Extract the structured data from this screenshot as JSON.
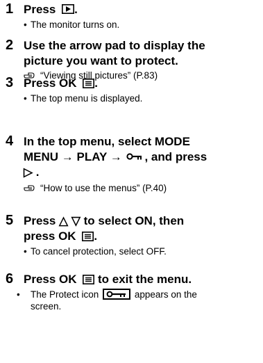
{
  "steps": [
    {
      "num": "1",
      "head_before": "Press",
      "head_after": ".",
      "button_icon": "playback-button-icon",
      "notes": [
        "The monitor turns on."
      ]
    },
    {
      "num": "2",
      "head_line1": "Use the arrow pad to display the",
      "head_line2": "picture you want to protect.",
      "ref_icon": "reference-hand-icon",
      "ref_text": "“Viewing still pictures” (P.83)"
    },
    {
      "num": "3",
      "head_before": "Press  OK",
      "head_after": ".",
      "button_icon": "menu-button-icon",
      "notes": [
        "The top menu is displayed."
      ]
    },
    {
      "num": "4",
      "head_line1": "In the top menu, select MODE",
      "head_line2_before": "MENU → PLAY →",
      "head_line2_after": ", and press",
      "head_line3": "▷ .",
      "key_icon": "protect-key-icon",
      "ref_icon": "reference-hand-icon",
      "ref_text": "“How to use the menus” (P.40)"
    },
    {
      "num": "5",
      "head_line1": "Press  △ ▽  to select ON, then",
      "head_line2_before": "press  OK",
      "head_line2_after": ".",
      "button_icon": "menu-button-icon",
      "notes": [
        "To cancel protection, select OFF."
      ]
    },
    {
      "num": "6",
      "head_before": "Press  OK",
      "head_after": " to exit the menu.",
      "button_icon": "menu-button-icon",
      "note_before": "The Protect icon",
      "note_after": "appears on the",
      "note_line2": "screen.",
      "protect_icon": "protect-indicator-icon"
    }
  ],
  "bullet": "•"
}
